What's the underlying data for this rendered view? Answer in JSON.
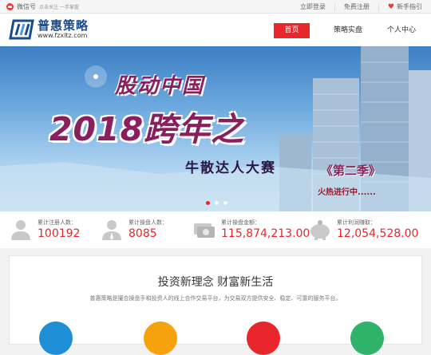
{
  "topbar": {
    "wechat_label": "微信号",
    "wechat_tip": "点击关注 一手掌握",
    "login": "立即登录",
    "register": "免费注册",
    "guide": "新手指引"
  },
  "header": {
    "logo_name": "普惠策略",
    "logo_url": "www.fzxltz.com",
    "nav": [
      {
        "label": "首页",
        "active": true
      },
      {
        "label": "策略实盘",
        "active": false
      },
      {
        "label": "个人中心",
        "active": false
      }
    ]
  },
  "banner": {
    "line1": "股动中国",
    "line2": "2018跨年之",
    "line3": "牛散达人大赛",
    "line4": "《第二季》",
    "line5": "火热进行中......",
    "slides": 3,
    "active_slide": 1
  },
  "stats": [
    {
      "label": "累计注册人数：",
      "value": "100192",
      "icon": "user-icon"
    },
    {
      "label": "累计操盘人数：",
      "value": "8085",
      "icon": "trader-icon"
    },
    {
      "label": "累计操盘金额：",
      "value": "115,874,213.00",
      "icon": "money-icon"
    },
    {
      "label": "累计利润赚取：",
      "value": "12,054,528.00",
      "icon": "piggy-bank-icon"
    }
  ],
  "section": {
    "title": "投资新理念 财富新生活",
    "desc": "普惠策略是撮合操盘手和投资人的线上合作交易平台，为交易双方提供安全、稳定、可靠的服务平台。"
  },
  "colors": {
    "accent": "#e8262b",
    "brand": "#1a4c8c"
  }
}
